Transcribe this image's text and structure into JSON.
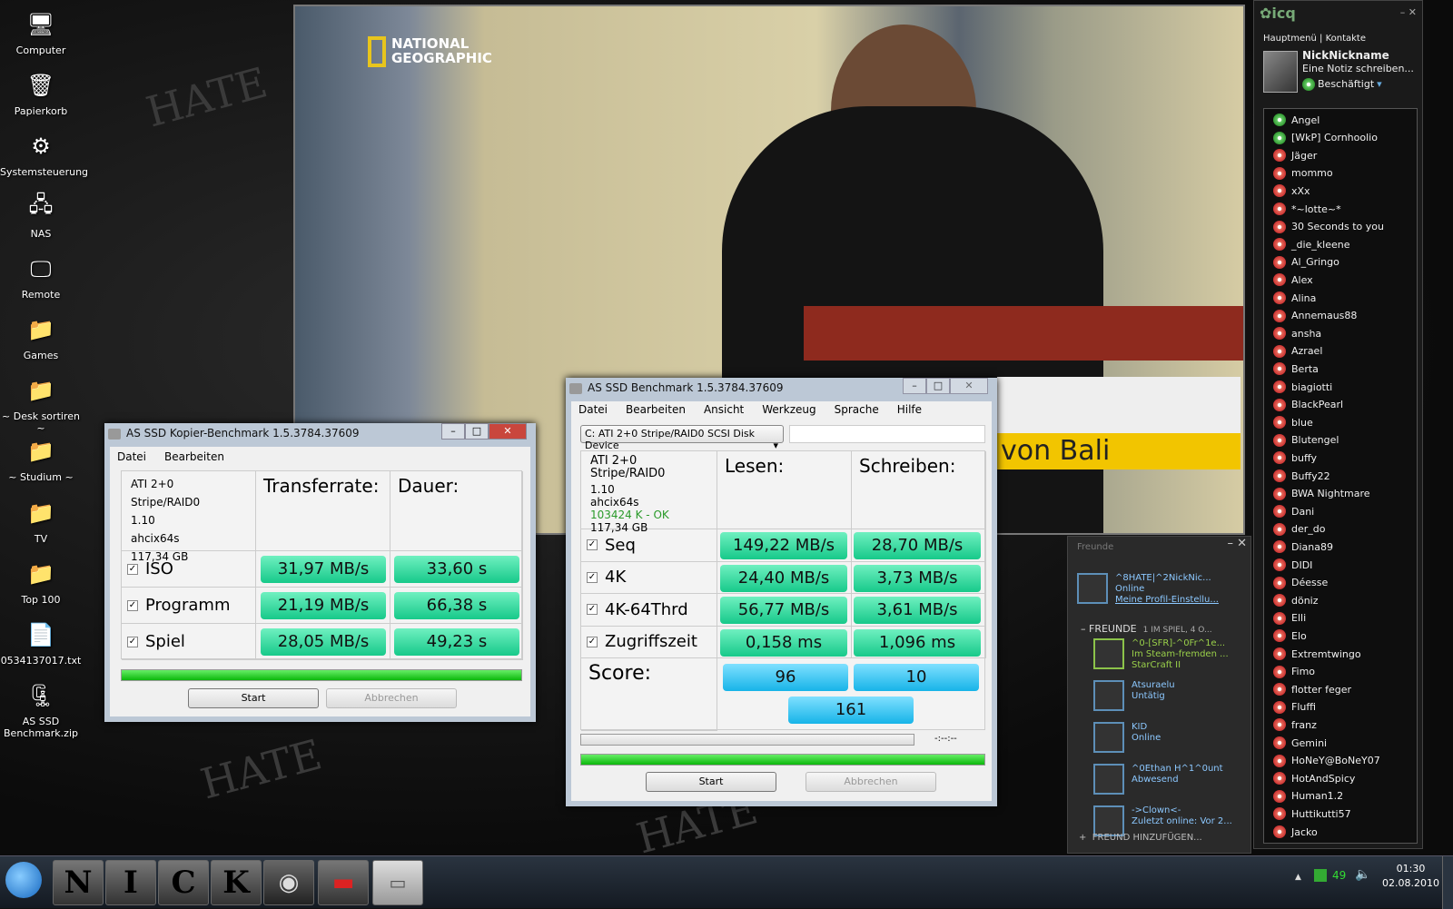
{
  "desktop": {
    "icons": [
      {
        "label": "Computer",
        "icon": "computer-icon"
      },
      {
        "label": "Papierkorb",
        "icon": "recycle-bin-icon"
      },
      {
        "label": "Systemsteuerung",
        "icon": "control-panel-icon"
      },
      {
        "label": "NAS",
        "icon": "network-icon"
      },
      {
        "label": "Remote",
        "icon": "remote-desktop-icon"
      },
      {
        "label": "Games",
        "icon": "folder-shortcut-icon"
      },
      {
        "label": "~ Desk sortiren ~",
        "icon": "folder-shortcut-icon"
      },
      {
        "label": "~ Studium ~",
        "icon": "folder-shortcut-icon"
      },
      {
        "label": "TV",
        "icon": "folder-shortcut-icon"
      },
      {
        "label": "Top 100",
        "icon": "folder-shortcut-icon"
      },
      {
        "label": "0534137017.txt",
        "icon": "text-file-icon"
      },
      {
        "label": "AS SSD Benchmark.zip",
        "icon": "zip-archive-icon"
      }
    ]
  },
  "video": {
    "logo": "NATIONAL GEOGRAPHIC",
    "subtitle": "von Bali"
  },
  "copy_bench": {
    "title": "AS SSD Kopier-Benchmark 1.5.3784.37609",
    "menu": [
      "Datei",
      "Bearbeiten"
    ],
    "drive": [
      "ATI 2+0 Stripe/RAID0",
      "1.10",
      "ahcix64s",
      "117,34 GB"
    ],
    "col_rate": "Transferrate:",
    "col_time": "Dauer:",
    "rows": [
      {
        "label": "ISO",
        "checked": true,
        "rate": "31,97 MB/s",
        "time": "33,60 s"
      },
      {
        "label": "Programm",
        "checked": true,
        "rate": "21,19 MB/s",
        "time": "66,38 s"
      },
      {
        "label": "Spiel",
        "checked": true,
        "rate": "28,05 MB/s",
        "time": "49,23 s"
      }
    ],
    "progress": 100,
    "start": "Start",
    "cancel": "Abbrechen"
  },
  "bench": {
    "title": "AS SSD Benchmark 1.5.3784.37609",
    "menu": [
      "Datei",
      "Bearbeiten",
      "Ansicht",
      "Werkzeug",
      "Sprache",
      "Hilfe"
    ],
    "device": "C: ATI 2+0 Stripe/RAID0 SCSI Disk Device",
    "drive": [
      "ATI 2+0 Stripe/RAID0",
      "1.10",
      "ahcix64s",
      "103424 K - OK",
      "117,34 GB"
    ],
    "col_read": "Lesen:",
    "col_write": "Schreiben:",
    "rows": [
      {
        "label": "Seq",
        "checked": true,
        "read": "149,22 MB/s",
        "write": "28,70 MB/s"
      },
      {
        "label": "4K",
        "checked": true,
        "read": "24,40 MB/s",
        "write": "3,73 MB/s"
      },
      {
        "label": "4K-64Thrd",
        "checked": true,
        "read": "56,77 MB/s",
        "write": "3,61 MB/s"
      },
      {
        "label": "Zugriffszeit",
        "checked": true,
        "read": "0,158 ms",
        "write": "1,096 ms"
      }
    ],
    "score_label": "Score:",
    "score_read": "96",
    "score_write": "10",
    "score_total": "161",
    "time": "-:--:--",
    "progress": 100,
    "start": "Start",
    "cancel": "Abbrechen"
  },
  "icq": {
    "logo": "icq",
    "menu_main": "Hauptmenü",
    "menu_contacts": "Kontakte",
    "nick": "NickNickname",
    "note": "Eine Notiz schreiben...",
    "status": "Beschäftigt",
    "contacts": [
      "Angel",
      "[WkP] Cornhoolio",
      "Jäger",
      "mommo",
      "xXx",
      "*~lotte~*",
      "30 Seconds to you",
      "_die_kleene",
      "Al_Gringo",
      "Alex",
      "Alina",
      "Annemaus88",
      "ansha",
      "Azrael",
      "Berta",
      "biagiotti",
      "BlackPearl",
      "blue",
      "Blutengel",
      "buffy",
      "Buffy22",
      "BWA Nightmare",
      "Dani",
      "der_do",
      "Diana89",
      "DIDI",
      "Déesse",
      "döniz",
      "Elli",
      "Elo",
      "Extremtwingo",
      "Fimo",
      "flotter feger",
      "Fluffi",
      "franz",
      "Gemini",
      "HoNeY@BoNeY07",
      "HotAndSpicy",
      "Human1.2",
      "Huttikutti57",
      "Jacko"
    ]
  },
  "steam": {
    "title": "Freunde",
    "me": {
      "name": "^8HATE|^2NickNic...",
      "status": "Online",
      "link": "Meine Profil-Einstellu..."
    },
    "group": "FREUNDE",
    "group_info": "1 IM SPIEL, 4 O...",
    "friends": [
      {
        "name": "^0-[SFR]-^0Fr^1e...",
        "status": "Im Steam-fremden ...",
        "game": "StarCraft II",
        "ingame": true
      },
      {
        "name": "Atsuraelu",
        "status": "Untätig"
      },
      {
        "name": "KID",
        "status": "Online"
      },
      {
        "name": "^0Ethan H^1^0unt",
        "status": "Abwesend"
      },
      {
        "name": "->Clown<-",
        "status": "Zuletzt online: Vor 2..."
      }
    ],
    "add": "FREUND HINZUFÜGEN..."
  },
  "taskbar": {
    "pins": [
      "N",
      "I",
      "C",
      "K"
    ],
    "tray_value": "49",
    "time": "01:30",
    "date": "02.08.2010"
  }
}
